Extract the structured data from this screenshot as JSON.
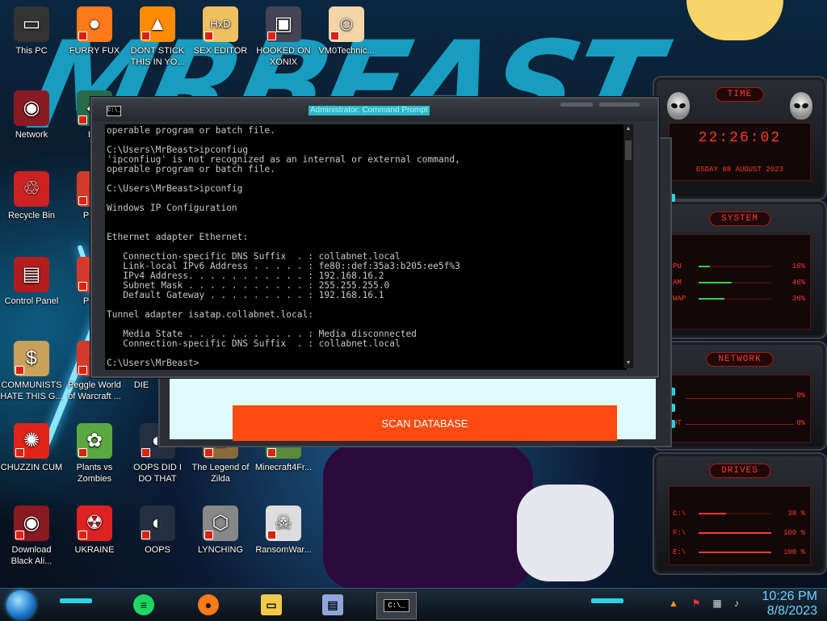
{
  "desktop_icons": [
    {
      "label": "This PC",
      "icon": "computer-icon"
    },
    {
      "label": "FURRY FUX",
      "icon": "firefox-icon"
    },
    {
      "label": "DONT STICK THIS IN YO...",
      "icon": "vlc-cone-icon"
    },
    {
      "label": "SEX EDITOR",
      "icon": "hxd-editor-icon"
    },
    {
      "label": "HOOKED ON XONIX",
      "icon": "xonix-game-icon"
    },
    {
      "label": "VM0Technic...",
      "icon": "doctor-figure-icon"
    },
    {
      "label": "Network",
      "icon": "network-orb-icon"
    },
    {
      "label": "DU",
      "icon": "app-icon"
    },
    {
      "label": "Recycle Bin",
      "icon": "recycle-bin-icon"
    },
    {
      "label": "Peggl",
      "icon": "peggle-icon"
    },
    {
      "label": "Control Panel",
      "icon": "control-panel-icon"
    },
    {
      "label": "Peggl",
      "icon": "peggle-icon"
    },
    {
      "label": "COMMUNISTS HATE THIS G...",
      "icon": "money-bag-icon"
    },
    {
      "label": "Peggle World of Warcraft ...",
      "icon": "peggle-icon"
    },
    {
      "label": "DIE",
      "icon": "app-icon"
    },
    {
      "label": "CHUZZIN CUM",
      "icon": "chuzzle-icon"
    },
    {
      "label": "Plants vs Zombies",
      "icon": "plants-vs-zombies-icon"
    },
    {
      "label": "OOPS DID I DO THAT",
      "icon": "oops-icon"
    },
    {
      "label": "The Legend of Zilda",
      "icon": "zelda-icon"
    },
    {
      "label": "Minecraft4Fr...",
      "icon": "minecraft-icon"
    },
    {
      "label": "Download Black Ali...",
      "icon": "alien-orb-icon"
    },
    {
      "label": "UKRAINE",
      "icon": "radiation-icon"
    },
    {
      "label": "OOPS",
      "icon": "oops-icon"
    },
    {
      "label": "LYNCHING",
      "icon": "lynching-icon"
    },
    {
      "label": "RansomWar...",
      "icon": "skull-icon"
    }
  ],
  "gadgets": {
    "time": {
      "header": "TIME",
      "clock": "22:26:02",
      "date": "ESDAY 08 AUGUST 2023"
    },
    "system": {
      "header": "SYSTEM",
      "rows": [
        {
          "label": "PU",
          "value": "16%",
          "fill": 0.16
        },
        {
          "label": "AM",
          "value": "46%",
          "fill": 0.46
        },
        {
          "label": "WAP",
          "value": "36%",
          "fill": 0.36
        }
      ]
    },
    "network": {
      "header": "NETWORK",
      "rows": [
        {
          "label": "",
          "value": "0%"
        },
        {
          "label": "UT",
          "value": "0%"
        }
      ]
    },
    "drives": {
      "header": "DRIVES",
      "rows": [
        {
          "label": "C:\\",
          "value": "38 %",
          "fill": 0.38
        },
        {
          "label": "F:\\",
          "value": "100 %",
          "fill": 1.0
        },
        {
          "label": "E:\\",
          "value": "100 %",
          "fill": 1.0
        }
      ]
    }
  },
  "app_window": {
    "button_label": "SCAN DATABASE"
  },
  "cmd_window": {
    "title": "Administrator: Command Prompt",
    "icon_text": "C:\\_",
    "lines": [
      "operable program or batch file.",
      "",
      "C:\\Users\\MrBeast>ipconfiug",
      "'ipconfiug' is not recognized as an internal or external command,",
      "operable program or batch file.",
      "",
      "C:\\Users\\MrBeast>ipconfig",
      "",
      "Windows IP Configuration",
      "",
      "",
      "Ethernet adapter Ethernet:",
      "",
      "   Connection-specific DNS Suffix  . : collabnet.local",
      "   Link-local IPv6 Address . . . . . : fe80::def:35a3:b205:ee5f%3",
      "   IPv4 Address. . . . . . . . . . . : 192.168.16.2",
      "   Subnet Mask . . . . . . . . . . . : 255.255.255.0",
      "   Default Gateway . . . . . . . . . : 192.168.16.1",
      "",
      "Tunnel adapter isatap.collabnet.local:",
      "",
      "   Media State . . . . . . . . . . . : Media disconnected",
      "   Connection-specific DNS Suffix  . : collabnet.local",
      "",
      "C:\\Users\\MrBeast>"
    ]
  },
  "taskbar": {
    "items": [
      {
        "icon": "spotify-icon",
        "color": "#1ed760"
      },
      {
        "icon": "firefox-icon",
        "color": "#ff7a1a"
      },
      {
        "icon": "file-explorer-icon",
        "color": "#f3c94b"
      },
      {
        "icon": "app-window-icon",
        "color": "#8fa7d8"
      },
      {
        "icon": "command-prompt-icon",
        "color": "#000000",
        "active": true
      }
    ],
    "clock_time": "10:26 PM",
    "clock_date": "8/8/2023"
  },
  "colors": {
    "accent_red": "#ff3b2a",
    "accent_cyan": "#2bd3e6",
    "scan_button": "#ff4b10"
  }
}
